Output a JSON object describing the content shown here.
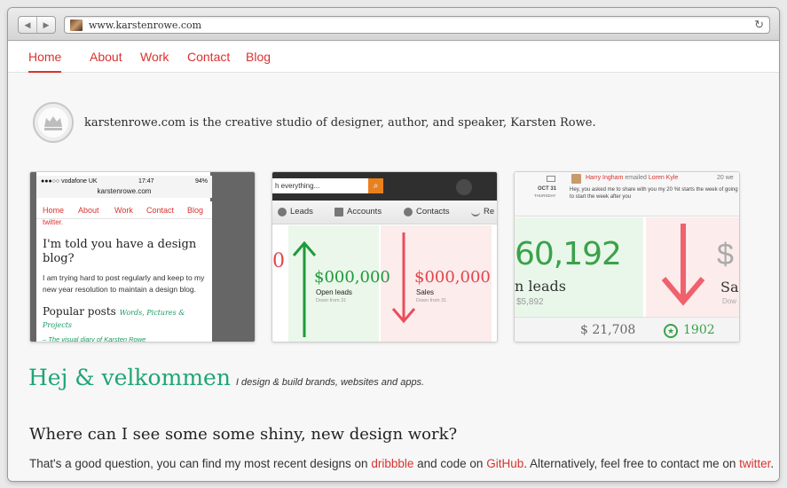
{
  "browser": {
    "url": "www.karstenrowe.com",
    "back_icon": "◀",
    "forward_icon": "▶",
    "reload_icon": "↻"
  },
  "nav": {
    "items": [
      "Home",
      "About",
      "Work",
      "Contact",
      "Blog"
    ],
    "active": "Home"
  },
  "intro": {
    "text": "karstenrowe.com is the creative studio of designer, author, and speaker, Karsten Rowe."
  },
  "thumb_phone": {
    "carrier": "●●●○○ vodafone UK",
    "time": "17:47",
    "battery": "94%",
    "url": "karstenrowe.com",
    "nav": [
      "Home",
      "About",
      "Work",
      "Contact",
      "Blog"
    ],
    "twitter": "twitter.",
    "heading": "I'm told you have a design blog?",
    "paragraph": "I am trying hard to post regularly and keep to my new year resolution to maintain a design blog.",
    "popular": "Popular posts",
    "popular_sub": "Words, Pictures & Projects",
    "footer": "– The visual diary of Karsten Rowe"
  },
  "thumb_dashboard": {
    "search_placeholder": "h everything...",
    "tabs": [
      "Leads",
      "Accounts",
      "Contacts",
      "Re"
    ],
    "left_value": "0",
    "green_value": "$000,000",
    "green_label": "Open leads",
    "green_sub": "Down from 31",
    "red_value": "$000,000",
    "red_label": "Sales",
    "red_sub": "Down from 31"
  },
  "thumb_stats": {
    "sender": "Harry Ingham",
    "emailed": "emailed",
    "recipient": "Loren Kyle",
    "time": "20 we",
    "date": "OCT 31",
    "day": "THURSDAY",
    "message": "Hey, you asked me to share with you my 20 %t starts the week of going to start the week after you",
    "big_value": "60,192",
    "big_label": "n leads",
    "small_value": "$5,892",
    "red_dollar": "$",
    "red_label": "Sal",
    "red_sub": "Dow",
    "bottom_value": "$ 21,708",
    "badge_value": "1902"
  },
  "hej": {
    "title": "Hej & velkommen",
    "subtitle": "I design & build brands, websites and apps."
  },
  "question": "Where can I see some some shiny, new design work?",
  "paragraph": {
    "p1": "That's a good question, you can find my most recent designs on ",
    "link1": "dribbble",
    "p2": " and code on ",
    "link2": "GitHub",
    "p3": ". Alternatively, feel free to contact me on ",
    "link3": "twitter",
    "p4": "."
  }
}
